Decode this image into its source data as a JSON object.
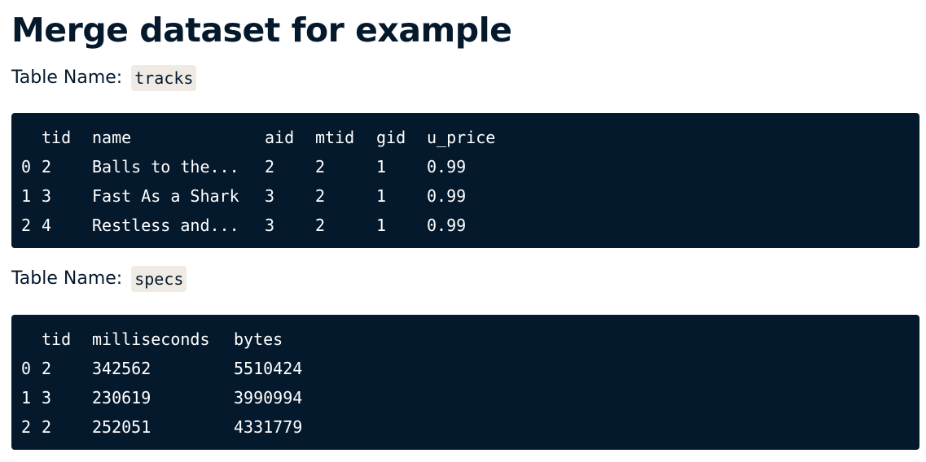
{
  "heading": "Merge dataset for example",
  "tables": [
    {
      "label_prefix": "Table Name:",
      "name": "tracks",
      "columns": [
        "",
        "tid",
        "name",
        "aid",
        "mtid",
        "gid",
        "u_price"
      ],
      "rows": [
        [
          "0",
          "2",
          "Balls to the...",
          "2",
          "2",
          "1",
          "0.99"
        ],
        [
          "1",
          "3",
          "Fast As a Shark",
          "3",
          "2",
          "1",
          "0.99"
        ],
        [
          "2",
          "4",
          "Restless and...",
          "3",
          "2",
          "1",
          "0.99"
        ]
      ]
    },
    {
      "label_prefix": "Table Name:",
      "name": "specs",
      "columns": [
        "",
        "tid",
        "milliseconds",
        "bytes"
      ],
      "rows": [
        [
          "0",
          "2",
          "342562",
          "5510424"
        ],
        [
          "1",
          "3",
          "230619",
          "3990994"
        ],
        [
          "2",
          "2",
          "252051",
          "4331779"
        ]
      ]
    }
  ],
  "colors": {
    "text": "#05192d",
    "code_bg": "#05192d",
    "code_text": "#ffffff",
    "chip_bg": "#efebe4"
  }
}
